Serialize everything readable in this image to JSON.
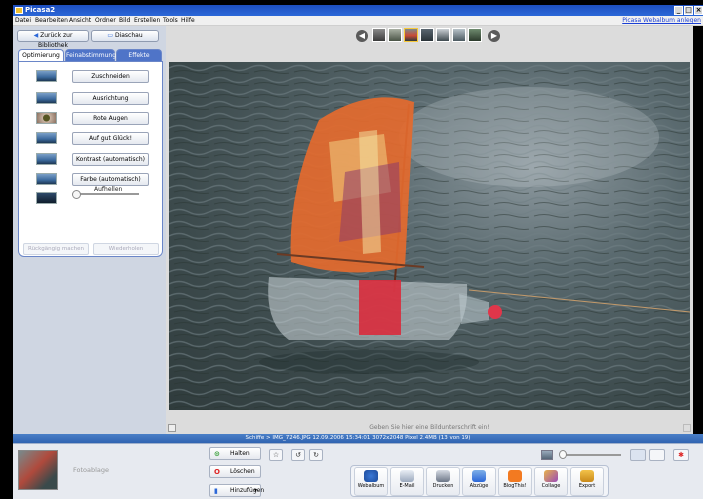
{
  "window": {
    "title": "Picasa2",
    "minimize": "_",
    "maximize": "□",
    "close": "×"
  },
  "menu": [
    "Datei",
    "Bearbeiten",
    "Ansicht",
    "Ordner",
    "Bild",
    "Erstellen",
    "Tools",
    "Hilfe"
  ],
  "web_album_link": "Picasa Webalbum anlegen",
  "nav": {
    "back": "Zurück zur Bibliothek",
    "slideshow": "Diaschau"
  },
  "tabs": [
    "Optimierung",
    "Feinabstimmung",
    "Effekte"
  ],
  "tools": [
    "Zuschneiden",
    "Ausrichtung",
    "Rote Augen",
    "Auf gut Glück!",
    "Kontrast (automatisch)",
    "Farbe (automatisch)"
  ],
  "brightness_label": "Aufhellen",
  "undo": {
    "undo": "Rückgängig machen",
    "redo": "Wiederholen"
  },
  "caption_placeholder": "Geben Sie hier eine Bildunterschrift ein!",
  "info": "Schiffe > IMG_7246.JPG   12.09.2006 15:34:01   3072x2048 Pixel   2.4MB   (13 von 19)",
  "tray": {
    "label": "Fotoablage",
    "hold": "Halten",
    "delete": "Löschen",
    "add": "Hinzufügen"
  },
  "share": [
    "Webalbum",
    "E-Mail",
    "Drucken",
    "Abzüge",
    "BlogThis!",
    "Collage",
    "Export"
  ],
  "colors": {
    "accent": "#2b67d8",
    "panel": "#cfd6e2",
    "sail": "#e05a2a",
    "bottle": "#d92b3c"
  }
}
